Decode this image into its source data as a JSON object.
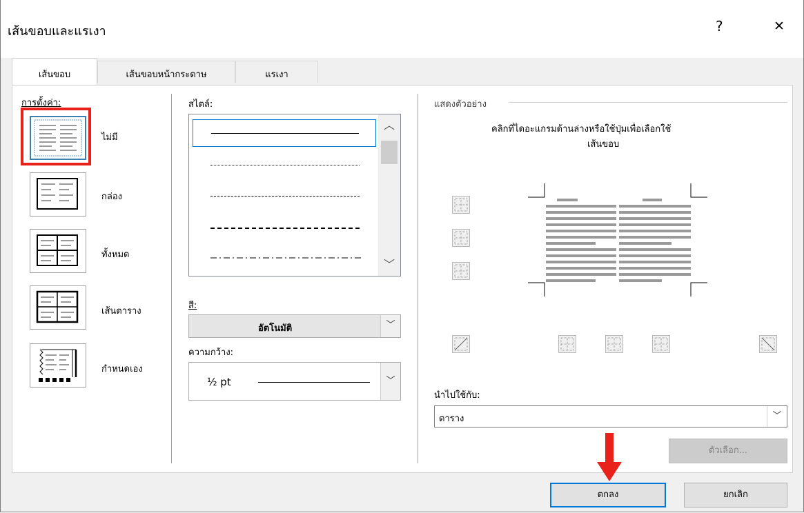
{
  "title": "เส้นขอบและแรเงา",
  "help": "?",
  "close": "✕",
  "tabs": [
    "เส้นขอบ",
    "เส้นขอบหน้ากระดาษ",
    "แรเงา"
  ],
  "setting": {
    "label": "การตั้งค่า:",
    "items": [
      "ไม่มี",
      "กล่อง",
      "ทั้งหมด",
      "เส้นตาราง",
      "กำหนดเอง"
    ]
  },
  "style": {
    "label": "สไตล์:"
  },
  "color": {
    "label": "สี:",
    "value": "อัตโนมัติ"
  },
  "width": {
    "label": "ความกว้าง:",
    "value": "½ pt"
  },
  "preview": {
    "label": "แสดงตัวอย่าง",
    "hint1": "คลิกที่ไดอะแกรมด้านล่างหรือใช้ปุ่มเพื่อเลือกใช้",
    "hint2": "เส้นขอบ"
  },
  "apply": {
    "label": "นำไปใช้กับ:",
    "value": "ตาราง"
  },
  "options_button": "ตัวเลือก...",
  "ok_button": "ตกลง",
  "cancel_button": "ยกเลิก",
  "annotation_color": "#e8211b",
  "ok_border_color": "#0078d7"
}
